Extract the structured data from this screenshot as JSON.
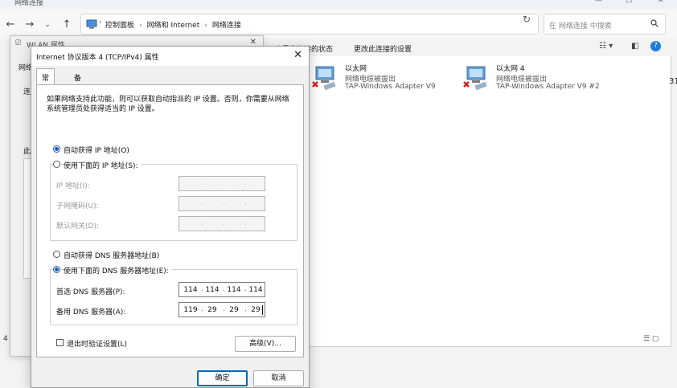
{
  "explorer": {
    "window_title": "网络连接",
    "address_path": [
      "控制面板",
      "网络和 Internet",
      "网络连接"
    ],
    "search_placeholder": "在 网络连接 中搜索",
    "commands": [
      "查看此连接的状态",
      "更改此连接的设置"
    ],
    "adapters": [
      {
        "name": "以太网",
        "status": "网络电缆被拔出",
        "device": "TAP-Windows Adapter V9"
      },
      {
        "name": "以太网 4",
        "status": "网络电缆被拔出",
        "device": "TAP-Windows Adapter V9 #2"
      }
    ],
    "edge_text": "31",
    "left_edge_digit": "4"
  },
  "wlan": {
    "title": "WLAN 属性",
    "frag_network": "网络",
    "frag_connect": "连",
    "frag_this": "此"
  },
  "dialog": {
    "title": "Internet 协议版本 4 (TCP/IPv4) 属性",
    "tabs": [
      "常规",
      "备用配置"
    ],
    "intro": "如果网络支持此功能，则可以获取自动指派的 IP 设置。否则，你需要从网络系统管理员处获得适当的 IP 设置。",
    "ip_auto_label": "自动获得 IP 地址(O)",
    "ip_manual_label": "使用下面的 IP 地址(S):",
    "ip_auto_selected": true,
    "ip_fields": [
      {
        "label": "IP 地址(I):",
        "octets": [
          "",
          "",
          "",
          ""
        ]
      },
      {
        "label": "子网掩码(U):",
        "octets": [
          "",
          "",
          "",
          ""
        ]
      },
      {
        "label": "默认网关(D):",
        "octets": [
          "",
          "",
          "",
          ""
        ]
      }
    ],
    "dns_auto_label": "自动获得 DNS 服务器地址(B)",
    "dns_manual_label": "使用下面的 DNS 服务器地址(E):",
    "dns_manual_selected": true,
    "dns_fields": [
      {
        "label": "首选 DNS 服务器(P):",
        "octets": [
          "114",
          "114",
          "114",
          "114"
        ]
      },
      {
        "label": "备用 DNS 服务器(A):",
        "octets": [
          "119",
          "29",
          "29",
          "29"
        ]
      }
    ],
    "validate_label": "退出时验证设置(L)",
    "validate_checked": false,
    "advanced_button": "高级(V)...",
    "ok_button": "确定",
    "cancel_button": "取消"
  }
}
